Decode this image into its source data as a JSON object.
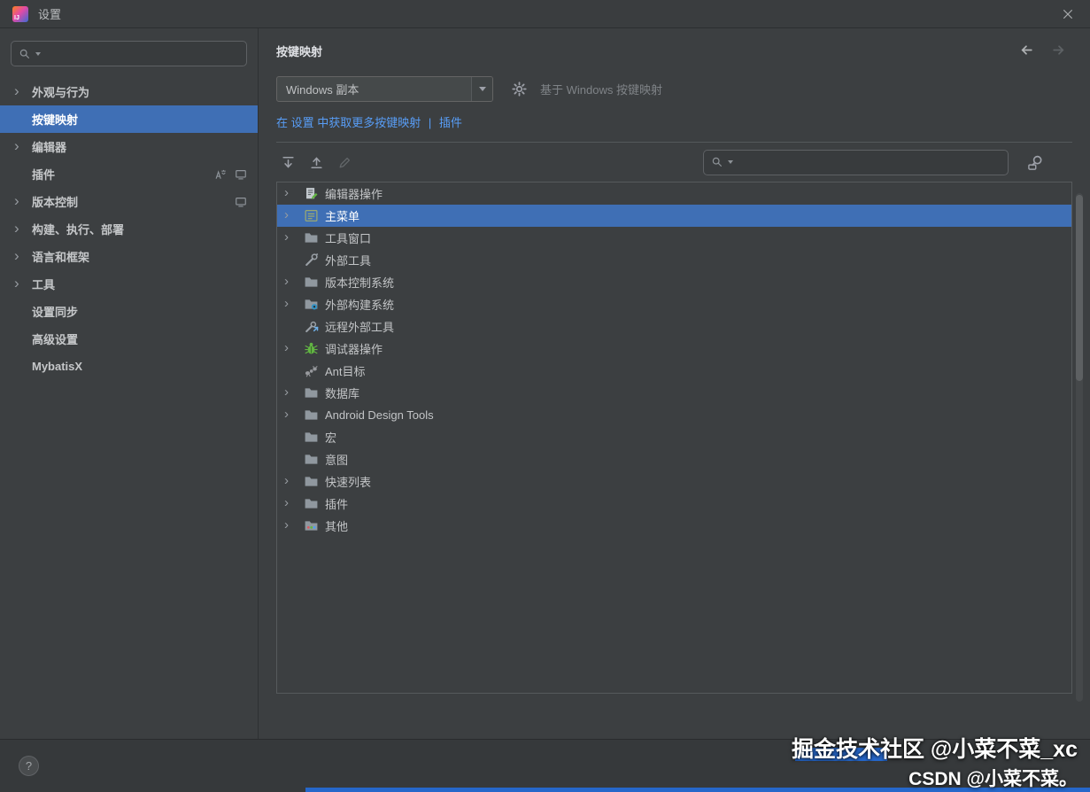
{
  "window": {
    "title": "设置"
  },
  "colors": {
    "selection": "#3f6fb5",
    "link": "#589df6",
    "accent": "#2667ca"
  },
  "sidebar": {
    "items": [
      {
        "label": "外观与行为",
        "expandable": true
      },
      {
        "label": "按键映射",
        "selected": true
      },
      {
        "label": "编辑器",
        "expandable": true
      },
      {
        "label": "插件"
      },
      {
        "label": "版本控制",
        "expandable": true
      },
      {
        "label": "构建、执行、部署",
        "expandable": true
      },
      {
        "label": "语言和框架",
        "expandable": true
      },
      {
        "label": "工具",
        "expandable": true
      },
      {
        "label": "设置同步"
      },
      {
        "label": "高级设置"
      },
      {
        "label": "MybatisX"
      }
    ]
  },
  "main": {
    "title": "按键映射",
    "keymap_select": {
      "value": "Windows 副本"
    },
    "based_on": "基于 Windows 按键映射",
    "links": {
      "more": "在 设置 中获取更多按键映射",
      "sep": "|",
      "plugins": "插件"
    },
    "tree": [
      {
        "label": "编辑器操作",
        "expandable": true
      },
      {
        "label": "主菜单",
        "expandable": true,
        "selected": true
      },
      {
        "label": "工具窗口",
        "expandable": true
      },
      {
        "label": "外部工具"
      },
      {
        "label": "版本控制系统",
        "expandable": true
      },
      {
        "label": "外部构建系统",
        "expandable": true
      },
      {
        "label": "远程外部工具"
      },
      {
        "label": "调试器操作",
        "expandable": true
      },
      {
        "label": "Ant目标"
      },
      {
        "label": "数据库",
        "expandable": true
      },
      {
        "label": "Android Design Tools",
        "expandable": true
      },
      {
        "label": "宏"
      },
      {
        "label": "意图"
      },
      {
        "label": "快速列表",
        "expandable": true
      },
      {
        "label": "插件",
        "expandable": true
      },
      {
        "label": "其他",
        "expandable": true
      }
    ]
  },
  "bottom": {
    "help_label": "?"
  },
  "watermark": {
    "line1": "掘金技术社区 @小菜不菜_xc",
    "line2": "CSDN @小菜不菜。"
  }
}
